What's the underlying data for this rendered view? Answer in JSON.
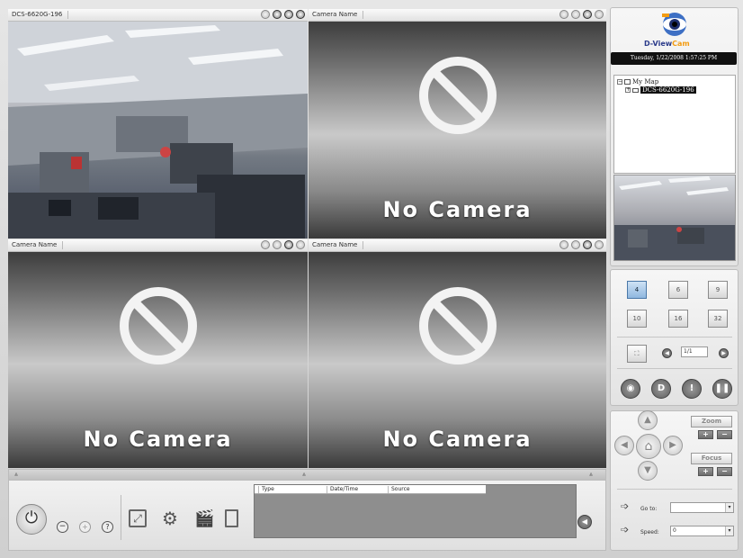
{
  "panes": [
    {
      "title": "DCS-6620G-196",
      "state": "live"
    },
    {
      "title": "Camera Name",
      "state": "empty",
      "message": "No Camera"
    },
    {
      "title": "Camera Name",
      "state": "empty",
      "message": "No Camera"
    },
    {
      "title": "Camera Name",
      "state": "empty",
      "message": "No Camera"
    }
  ],
  "brand": {
    "prefix": "D-View",
    "suffix": "Cam",
    "icon": "eye-icon"
  },
  "datetime": "Tuesday, 1/22/2008 1:57:25 PM",
  "tree": {
    "root": "My Map",
    "child": "DCS-6620G-196"
  },
  "layouts": [
    "4",
    "6",
    "9",
    "10",
    "16",
    "32"
  ],
  "paging": {
    "page": "1/1"
  },
  "ptz": {
    "zoom_label": "Zoom",
    "focus_label": "Focus",
    "plus": "+",
    "minus": "−"
  },
  "goto": {
    "label": "Go to:",
    "value": ""
  },
  "speed": {
    "label": "Speed:",
    "value": "0"
  },
  "log": {
    "columns": [
      "Type",
      "Date/Time",
      "Source"
    ]
  },
  "icons": {
    "help": "?"
  }
}
